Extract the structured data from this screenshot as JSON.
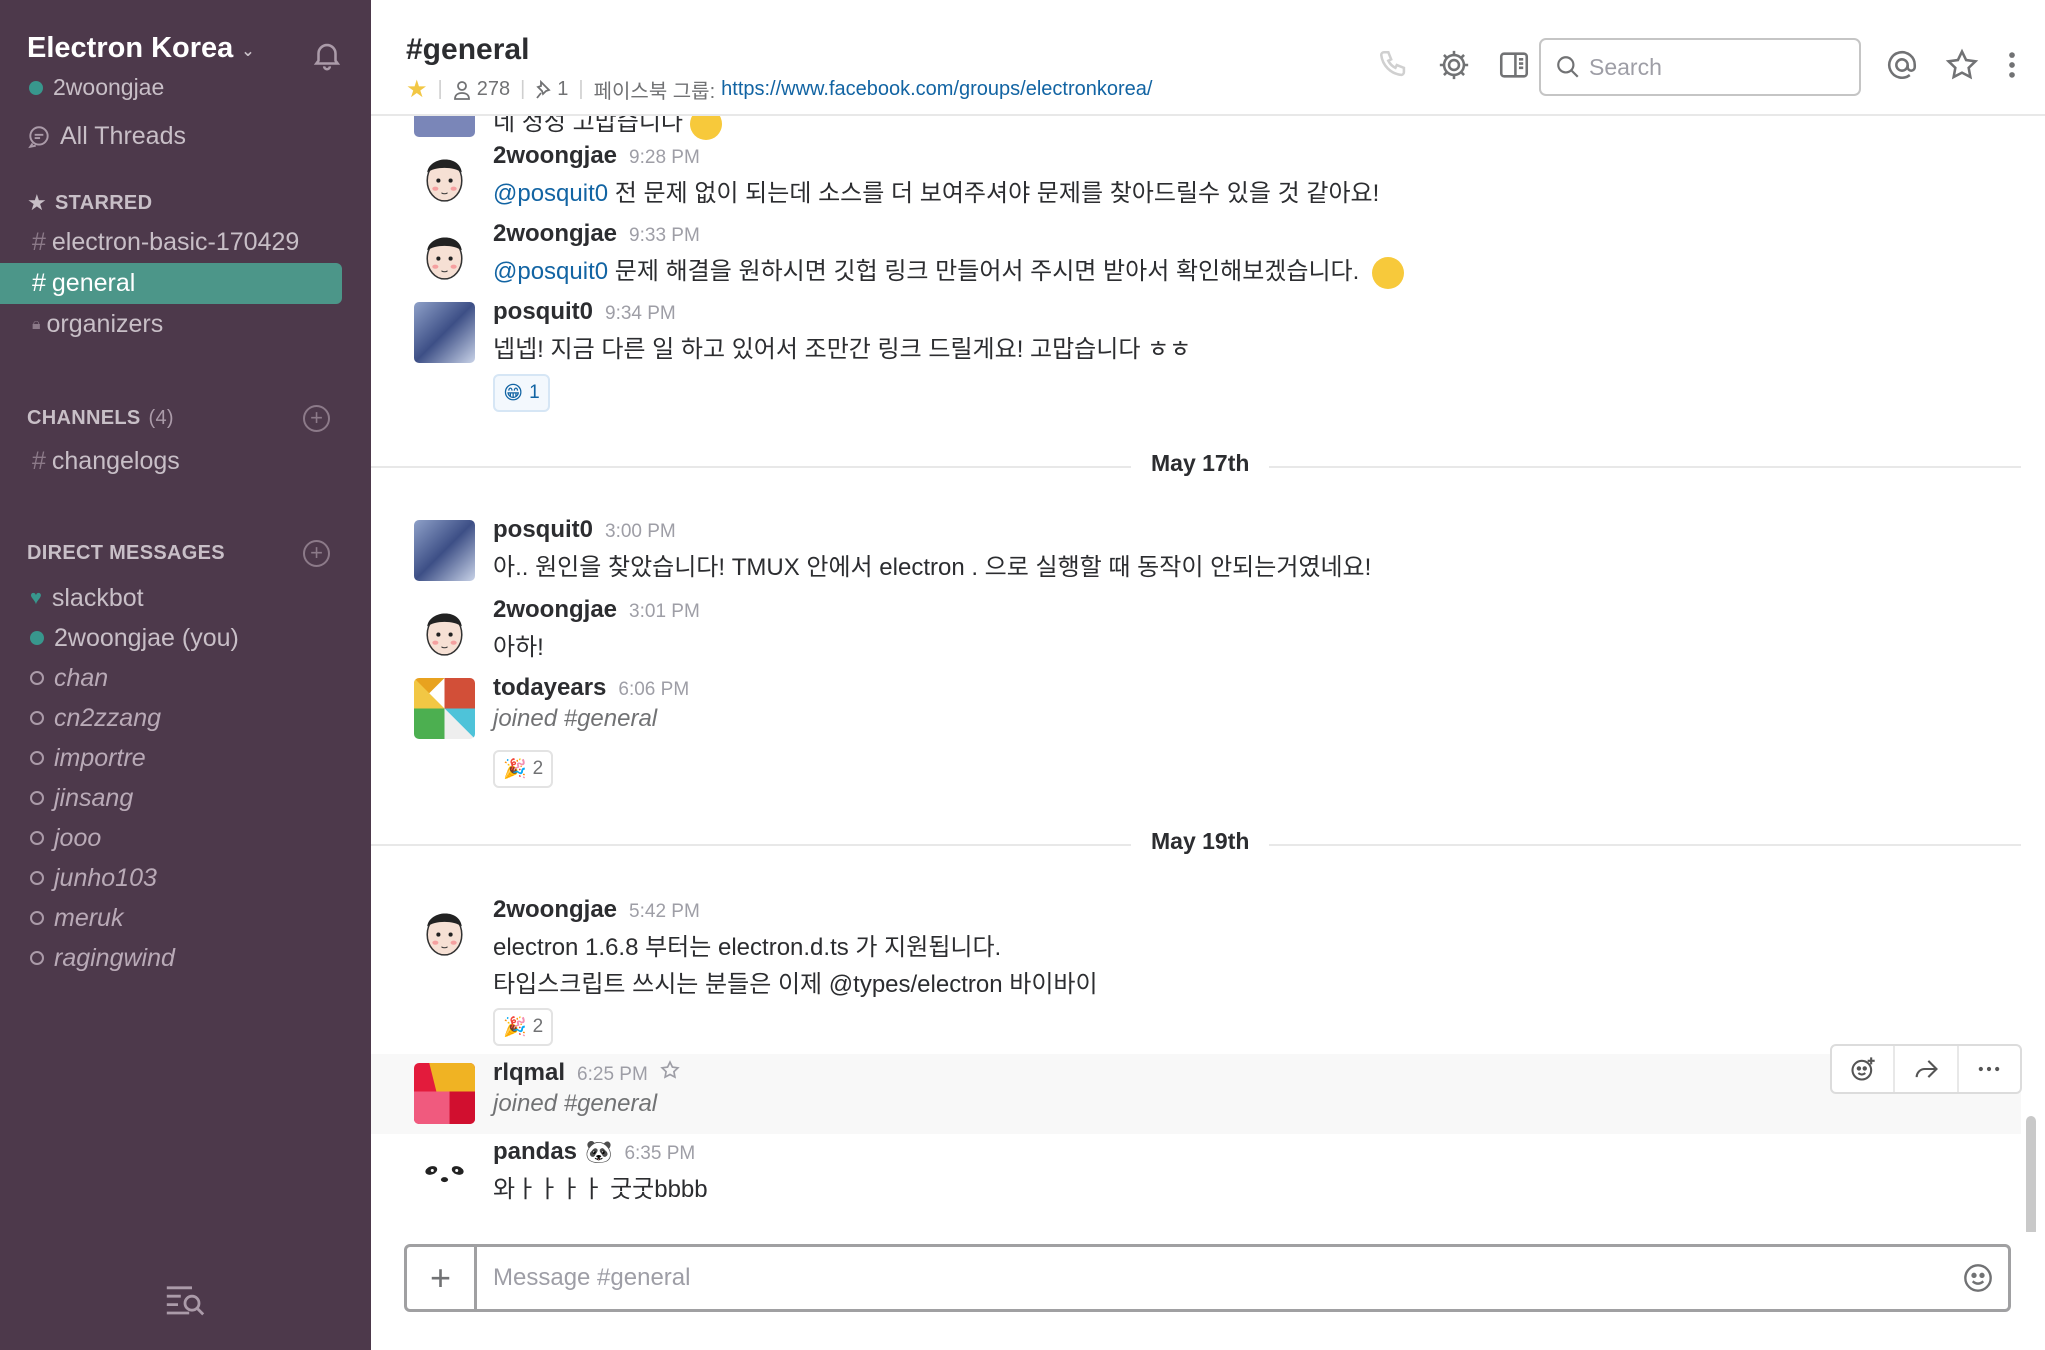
{
  "sidebar": {
    "team_name": "Electron Korea",
    "user_name": "2woongjae",
    "all_threads": "All Threads",
    "starred_label": "STARRED",
    "starred": [
      {
        "name": "electron-basic-170429",
        "icon": "#"
      },
      {
        "name": "general",
        "icon": "#",
        "active": true
      },
      {
        "name": "organizers",
        "icon": "lock-icon"
      }
    ],
    "channels_label": "CHANNELS",
    "channels_count": "(4)",
    "channels": [
      {
        "name": "changelogs",
        "icon": "#"
      }
    ],
    "dm_label": "DIRECT MESSAGES",
    "dms": [
      {
        "name": "slackbot",
        "status": "heart"
      },
      {
        "name": "2woongjae (you)",
        "status": "online"
      },
      {
        "name": "chan",
        "status": "away"
      },
      {
        "name": "cn2zzang",
        "status": "away"
      },
      {
        "name": "importre",
        "status": "away"
      },
      {
        "name": "jinsang",
        "status": "away"
      },
      {
        "name": "jooo",
        "status": "away"
      },
      {
        "name": "junho103",
        "status": "away"
      },
      {
        "name": "meruk",
        "status": "away"
      },
      {
        "name": "ragingwind",
        "status": "away"
      }
    ]
  },
  "header": {
    "channel": "#general",
    "members": "278",
    "pins": "1",
    "topic_prefix": "페이스북 그룹:",
    "topic_link": "https://www.facebook.com/groups/electronkorea/",
    "search_placeholder": "Search"
  },
  "messages": [
    {
      "author": "2woongjae",
      "time": "9:28 PM",
      "mention": "@posquit0",
      "text": " 전 문제 없이 되는데 소스를 더 보여주셔야 문제를 찾아드릴수 있을 것 같아요!"
    },
    {
      "author": "2woongjae",
      "time": "9:33 PM",
      "mention": "@posquit0",
      "text": " 문제 해결을 원하시면 깃헙 링크 만들어서 주시면 받아서 확인해보겠습니다."
    },
    {
      "author": "posquit0",
      "time": "9:34 PM",
      "text": "넵넵! 지금 다른 일 하고 있어서 조만간 링크 드릴게요! 고맙습니다 ㅎㅎ",
      "reaction": {
        "emoji": "😁",
        "count": "1"
      }
    },
    {
      "author": "posquit0",
      "time": "3:00 PM",
      "text": "아.. 원인을 찾았습니다! TMUX 안에서 electron .  으로 실행할 때 동작이 안되는거였네요!"
    },
    {
      "author": "2woongjae",
      "time": "3:01 PM",
      "text": "아하!"
    },
    {
      "author": "todayears",
      "time": "6:06 PM",
      "text": "joined #general",
      "reaction": {
        "emoji": "🎉",
        "count": "2"
      }
    },
    {
      "author": "2woongjae",
      "time": "5:42 PM",
      "text": "electron 1.6.8 부터는 electron.d.ts 가 지원됩니다.",
      "text2": "타입스크립트 쓰시는 분들은 이제 @types/electron 바이바이",
      "reaction": {
        "emoji": "🎉",
        "count": "2"
      }
    },
    {
      "author": "rlqmal",
      "time": "6:25 PM",
      "text": "joined #general"
    },
    {
      "author": "pandas",
      "time": "6:35 PM",
      "text": "와ㅏㅏㅏㅏ 굿굿bbbb",
      "author_emoji": "🐼"
    }
  ],
  "partial_top_text": "네 정성 고맙습니다",
  "dividers": [
    "May 17th",
    "May 19th"
  ],
  "composer": {
    "placeholder": "Message #general"
  },
  "colors": {
    "sidebar": "#4d394b",
    "active_channel": "#4c9689",
    "link": "#1264a3",
    "star": "#f2c744"
  }
}
